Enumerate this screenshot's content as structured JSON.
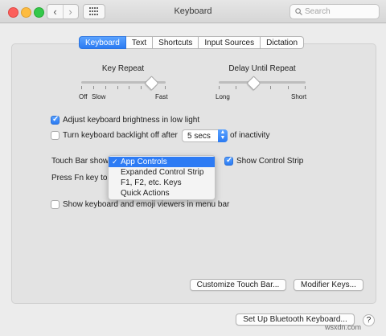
{
  "window": {
    "title": "Keyboard"
  },
  "toolbar": {
    "search_placeholder": "Search"
  },
  "tabs": [
    {
      "label": "Keyboard",
      "active": true
    },
    {
      "label": "Text",
      "active": false
    },
    {
      "label": "Shortcuts",
      "active": false
    },
    {
      "label": "Input Sources",
      "active": false
    },
    {
      "label": "Dictation",
      "active": false
    }
  ],
  "sliders": {
    "key_repeat": {
      "label": "Key Repeat",
      "min_label": "Off",
      "slow_label": "Slow",
      "max_label": "Fast",
      "value_fraction": 0.83,
      "ticks": 8
    },
    "delay_until_repeat": {
      "label": "Delay Until Repeat",
      "min_label": "Long",
      "max_label": "Short",
      "value_fraction": 0.4,
      "ticks": 6
    }
  },
  "options": {
    "adjust_brightness": {
      "label": "Adjust keyboard brightness in low light",
      "checked": true
    },
    "backlight_off": {
      "label": "Turn keyboard backlight off after",
      "checked": false,
      "value": "5 secs",
      "suffix": "of inactivity"
    }
  },
  "touch_bar": {
    "label": "Touch Bar shows",
    "options": [
      "App Controls",
      "Expanded Control Strip",
      "F1, F2, etc. Keys",
      "Quick Actions"
    ],
    "selected_index": 0,
    "show_control_strip": {
      "label": "Show Control Strip",
      "checked": true
    }
  },
  "fn_key": {
    "label": "Press Fn key to"
  },
  "show_viewers": {
    "label": "Show keyboard and emoji viewers in menu bar",
    "checked": false
  },
  "buttons": {
    "customize_touch_bar": "Customize Touch Bar...",
    "modifier_keys": "Modifier Keys...",
    "bluetooth_keyboard": "Set Up Bluetooth Keyboard...",
    "help": "?"
  },
  "watermark": "wsxdn.com",
  "colors": {
    "accent": "#2b7bf2",
    "menu_selection": "#2d7bf4",
    "window_bg": "#ececec"
  }
}
